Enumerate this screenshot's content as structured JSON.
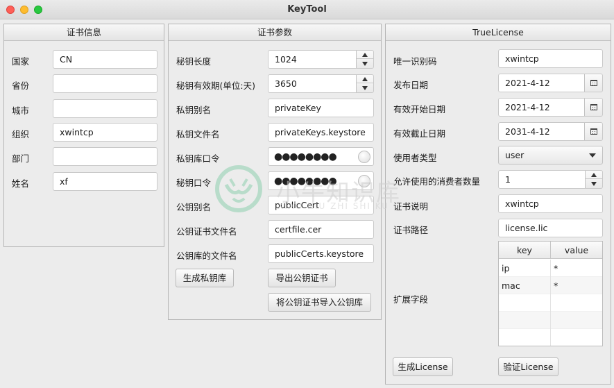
{
  "window": {
    "title": "KeyTool"
  },
  "cert_info": {
    "title": "证书信息",
    "rows": [
      {
        "label": "国家",
        "value": "CN"
      },
      {
        "label": "省份",
        "value": ""
      },
      {
        "label": "城市",
        "value": ""
      },
      {
        "label": "组织",
        "value": "xwintcp"
      },
      {
        "label": "部门",
        "value": ""
      },
      {
        "label": "姓名",
        "value": "xf"
      }
    ]
  },
  "cert_params": {
    "title": "证书参数",
    "key_length": {
      "label": "秘钥长度",
      "value": "1024"
    },
    "validity": {
      "label": "秘钥有效期(单位:天)",
      "value": "3650"
    },
    "private_alias": {
      "label": "私钥别名",
      "value": "privateKey"
    },
    "private_file": {
      "label": "私钥文件名",
      "value": "privateKeys.keystore"
    },
    "private_store_pwd": {
      "label": "私钥库口令",
      "value": "●●●●●●●●"
    },
    "key_pwd": {
      "label": "秘钥口令",
      "value": "●●●●●●●●"
    },
    "public_alias": {
      "label": "公钥别名",
      "value": "publicCert"
    },
    "public_cert_file": {
      "label": "公钥证书文件名",
      "value": "certfile.cer"
    },
    "public_store_file": {
      "label": "公钥库的文件名",
      "value": "publicCerts.keystore"
    },
    "buttons": {
      "gen_private": "生成私钥库",
      "export_cert": "导出公钥证书",
      "import_cert": "将公钥证书导入公钥库"
    }
  },
  "true_license": {
    "title": "TrueLicense",
    "unique_id": {
      "label": "唯一识别码",
      "value": "xwintcp"
    },
    "issue_date": {
      "label": "发布日期",
      "value": "2021-4-12"
    },
    "valid_start": {
      "label": "有效开始日期",
      "value": "2021-4-12"
    },
    "valid_end": {
      "label": "有效截止日期",
      "value": "2031-4-12"
    },
    "user_type": {
      "label": "使用者类型",
      "value": "user"
    },
    "consumer_count": {
      "label": "允许使用的消费者数量",
      "value": "1"
    },
    "description": {
      "label": "证书说明",
      "value": "xwintcp"
    },
    "path": {
      "label": "证书路径",
      "value": "license.lic"
    },
    "ext": {
      "label": "扩展字段",
      "columns": [
        "key",
        "value"
      ],
      "rows": [
        {
          "key": "ip",
          "value": "*"
        },
        {
          "key": "mac",
          "value": "*"
        }
      ]
    },
    "buttons": {
      "generate": "生成License",
      "verify": "验证License"
    }
  },
  "watermark": {
    "text": "小牛知识库",
    "sub": "XIAO NIU ZHI SHI KU"
  },
  "icons": {
    "spinner": "up-down-arrows-icon",
    "calendar": "calendar-icon",
    "reveal": "reveal-password-icon",
    "dropdown": "chevron-down-icon"
  }
}
